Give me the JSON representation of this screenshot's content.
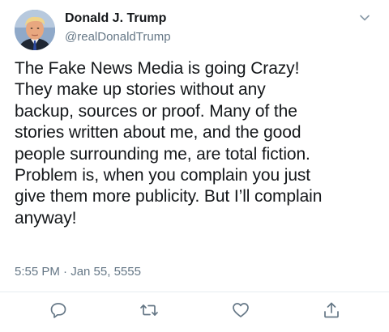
{
  "tweet": {
    "author_name": "Donald J. Trump",
    "author_handle": "@realDonaldTrump",
    "text": "The Fake News Media is going Crazy!\nThey make up stories without any\nbackup, sources or proof. Many of the\nstories written about me, and the good\npeople surrounding me, are total fiction.\nProblem is, when you complain you just\ngive them more publicity. But I’ll complain\nanyway!",
    "timestamp": "5:55 PM · Jan 55, 5555"
  },
  "icons": {
    "menu": "chevron-down-icon",
    "reply": "reply-icon",
    "retweet": "retweet-icon",
    "like": "heart-icon",
    "share": "share-icon"
  },
  "colors": {
    "text": "#14171a",
    "secondary": "#657786",
    "divider": "#e6ecf0"
  }
}
